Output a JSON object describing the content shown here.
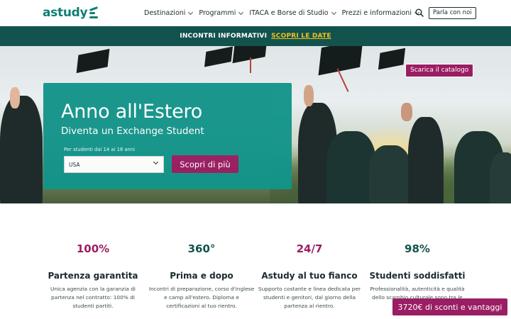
{
  "header": {
    "logo": "astudy",
    "nav": [
      {
        "label": "Destinazioni"
      },
      {
        "label": "Programmi"
      },
      {
        "label": "ITACA e Borse di Studio"
      },
      {
        "label": "Prezzi e informazioni"
      }
    ],
    "contact_label": "Parla con noi"
  },
  "banner": {
    "text": "INCONTRI INFORMATIVI",
    "link": "SCOPRI LE DATE",
    "link_color": "#f2c318"
  },
  "hero": {
    "catalog_label": "Scarica il catalogo",
    "title": "Anno all'Estero",
    "subtitle": "Diventa un Exchange Student",
    "age_label": "Per studenti dai 14 ai 18 anni",
    "country_value": "USA",
    "discover_label": "Scopri di più"
  },
  "stats": [
    {
      "value": "100%",
      "color": "#9a1e63",
      "title": "Partenza garantita",
      "desc": "Unica agenzia con la garanzia di partenza nel contratto: 100% di studenti partiti."
    },
    {
      "value": "360°",
      "color": "#12534e",
      "title": "Prima e dopo",
      "desc": "Incontri di preparazione, corso d'inglese e camp all'estero. Diploma e certificazioni al tuo rientro."
    },
    {
      "value": "24/7",
      "color": "#9a1e63",
      "title": "Astudy al tuo fianco",
      "desc": "Supporto costante e linea dedicata per studenti e genitori, dal giorno della partenza al rientro."
    },
    {
      "value": "98%",
      "color": "#12534e",
      "title": "Studenti soddisfatti",
      "desc": "Professionalità, autenticità e qualità dello scambio culturale sono tra le caratteristiche"
    }
  ],
  "promo_label": "3720€ di sconti e vantaggi",
  "colors": {
    "brand_teal": "#0f7f76",
    "brand_dark": "#12534e",
    "accent_magenta": "#9a1e63",
    "card_teal": "#14948a"
  }
}
